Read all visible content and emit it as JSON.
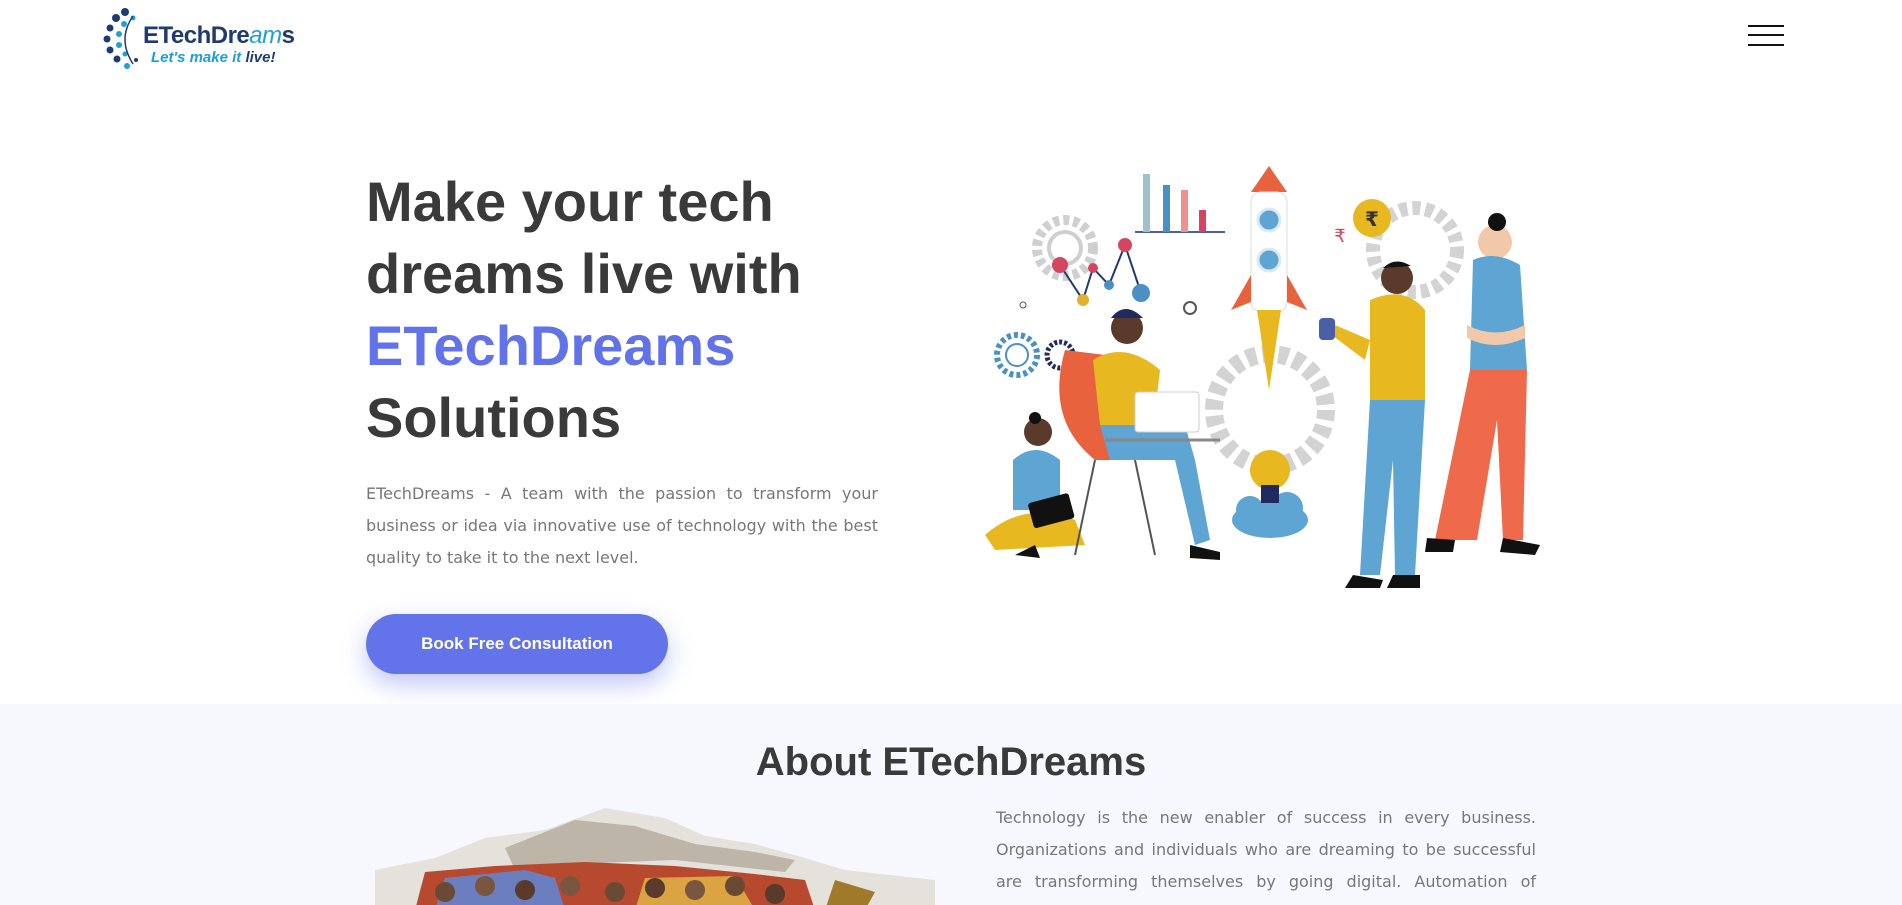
{
  "header": {
    "logo": {
      "name_main": "ETechDre",
      "name_accent": "am",
      "name_end": "s",
      "tagline_main": "Let's make it ",
      "tagline_end": "live!"
    },
    "menu_icon": "hamburger-menu-icon"
  },
  "hero": {
    "title_line1": "Make your tech",
    "title_line2": "dreams live with",
    "title_brand": "ETechDreams",
    "title_line4": "Solutions",
    "description": "ETechDreams - A team with the passion to transform your business or idea via innovative use of technology with the best quality to take it to the next level.",
    "cta_label": "Book Free Consultation",
    "illustration_currency": "₹"
  },
  "about": {
    "title": "About ETechDreams",
    "text": "Technology is the new enabler of success in every business. Organizations and individuals who are dreaming to be successful are transforming themselves by going digital. Automation of redundent"
  },
  "colors": {
    "brand_blue": "#6272e9",
    "heading": "#3a3a3a",
    "body_text": "#777777",
    "section_bg": "#f6f8fd"
  }
}
